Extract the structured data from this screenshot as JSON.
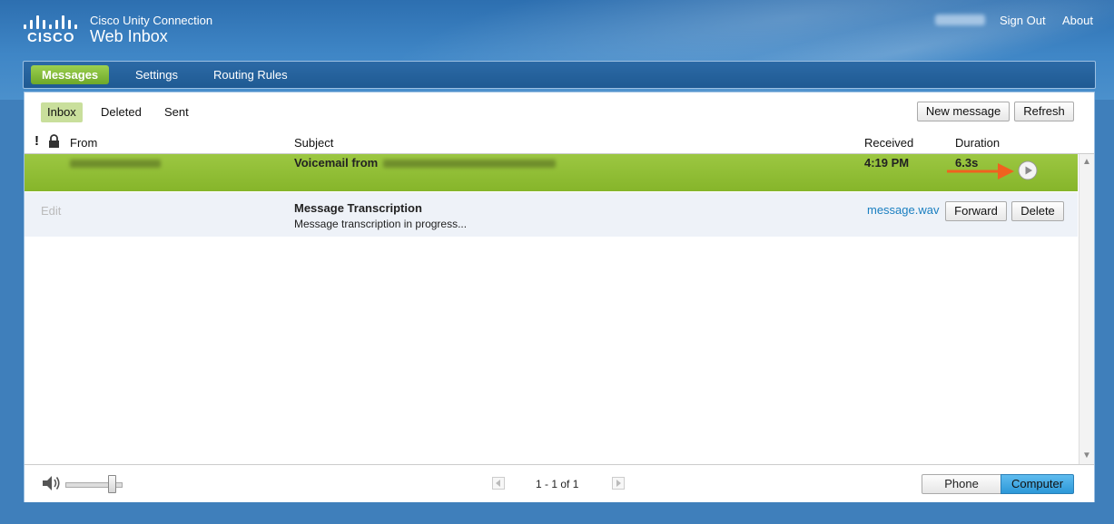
{
  "header": {
    "logo_text": "CISCO",
    "app_subtitle": "Cisco Unity Connection",
    "app_title": "Web Inbox",
    "sign_out": "Sign Out",
    "about": "About"
  },
  "nav": {
    "tabs": [
      {
        "label": "Messages",
        "active": true
      },
      {
        "label": "Settings",
        "active": false
      },
      {
        "label": "Routing Rules",
        "active": false
      }
    ]
  },
  "folders": {
    "tabs": [
      {
        "label": "Inbox",
        "active": true
      },
      {
        "label": "Deleted",
        "active": false
      },
      {
        "label": "Sent",
        "active": false
      }
    ],
    "new_message": "New message",
    "refresh": "Refresh"
  },
  "columns": {
    "urgent": "!",
    "from": "From",
    "subject": "Subject",
    "received": "Received",
    "duration": "Duration"
  },
  "message": {
    "subject_prefix": "Voicemail from",
    "received": "4:19 PM",
    "duration": "6.3s"
  },
  "detail": {
    "edit": "Edit",
    "title": "Message Transcription",
    "status": "Message transcription in progress...",
    "attachment": "message.wav",
    "forward": "Forward",
    "delete": "Delete"
  },
  "footer": {
    "pagination": "1 - 1 of 1",
    "phone": "Phone",
    "computer": "Computer"
  },
  "colors": {
    "accent_green": "#8fbd36",
    "link_blue": "#1a7fc0",
    "arrow_orange": "#f0621f",
    "selected_blue": "#36a4e0"
  }
}
